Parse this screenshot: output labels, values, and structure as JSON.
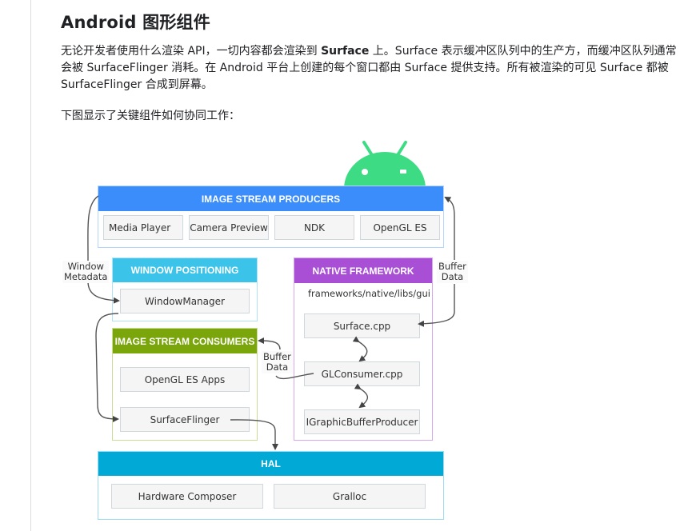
{
  "page": {
    "title": "Android 图形组件",
    "intro": {
      "before_bold": "无论开发者使用什么渲染 API，一切内容都会渲染到 ",
      "bold": "Surface",
      "after_bold_line1": " 上。Surface 表示缓冲区队列中的生产方，而缓冲区队列通常会被 SurfaceFlinger 消耗。在 Android 平台上创建的每个窗口都由 Surface 提供支持。所有被渲染的可见 Surface 都被 SurfaceFlinger 合成到屏幕。"
    },
    "caption": "下图显示了关键组件如何协同工作："
  },
  "diagram": {
    "logo": "android-robot",
    "producers": {
      "header": "IMAGE STREAM PRODUCERS",
      "color": "#3a8dfb",
      "items": [
        "Media Player",
        "Camera Preview",
        "NDK",
        "OpenGL ES"
      ]
    },
    "window_positioning": {
      "header": "WINDOW POSITIONING",
      "color": "#3cc3e9",
      "items": [
        "WindowManager"
      ]
    },
    "native_framework": {
      "header": "NATIVE FRAMEWORK",
      "color": "#a94fd6",
      "path": "frameworks/native/libs/gui",
      "items": [
        "Surface.cpp",
        "GLConsumer.cpp",
        "IGraphicBufferProducer"
      ]
    },
    "consumers": {
      "header": "IMAGE STREAM CONSUMERS",
      "color": "#7aa60c",
      "items": [
        "OpenGL ES Apps",
        "SurfaceFlinger"
      ]
    },
    "hal": {
      "header": "HAL",
      "color": "#00a9d6",
      "items": [
        "Hardware Composer",
        "Gralloc"
      ]
    },
    "edge_labels": {
      "window_metadata": "Window\nMetadata",
      "buffer_data_right": "Buffer\nData",
      "buffer_data_middle": "Buffer\nData"
    }
  }
}
